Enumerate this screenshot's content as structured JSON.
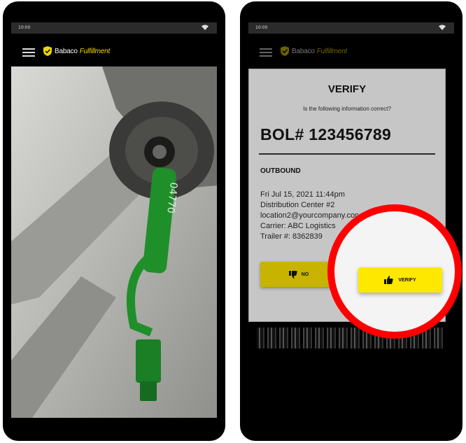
{
  "status_bar": {
    "time": "10:00"
  },
  "app": {
    "brand_name": "Babaco",
    "brand_sub": "Fulfillment"
  },
  "dialog": {
    "title": "VERIFY",
    "question": "Is the following information correct?",
    "bol": "BOL# 123456789",
    "direction": "OUTBOUND",
    "details": [
      "Fri Jul 15, 2021 11:44pm",
      "Distribution Center #2",
      "location2@yourcompany.com",
      "Carrier: ABC Logistics",
      "Trailer #: 8362839"
    ],
    "no_label": "NO",
    "verify_label": "VERIFY"
  },
  "colors": {
    "accent": "#FFE800",
    "highlight_ring": "#FF0000",
    "dialog_bg": "#C6C6C6"
  },
  "icons": [
    "menu-icon",
    "shield-icon",
    "wifi-icon",
    "thumbs-down-icon",
    "thumbs-up-icon"
  ]
}
